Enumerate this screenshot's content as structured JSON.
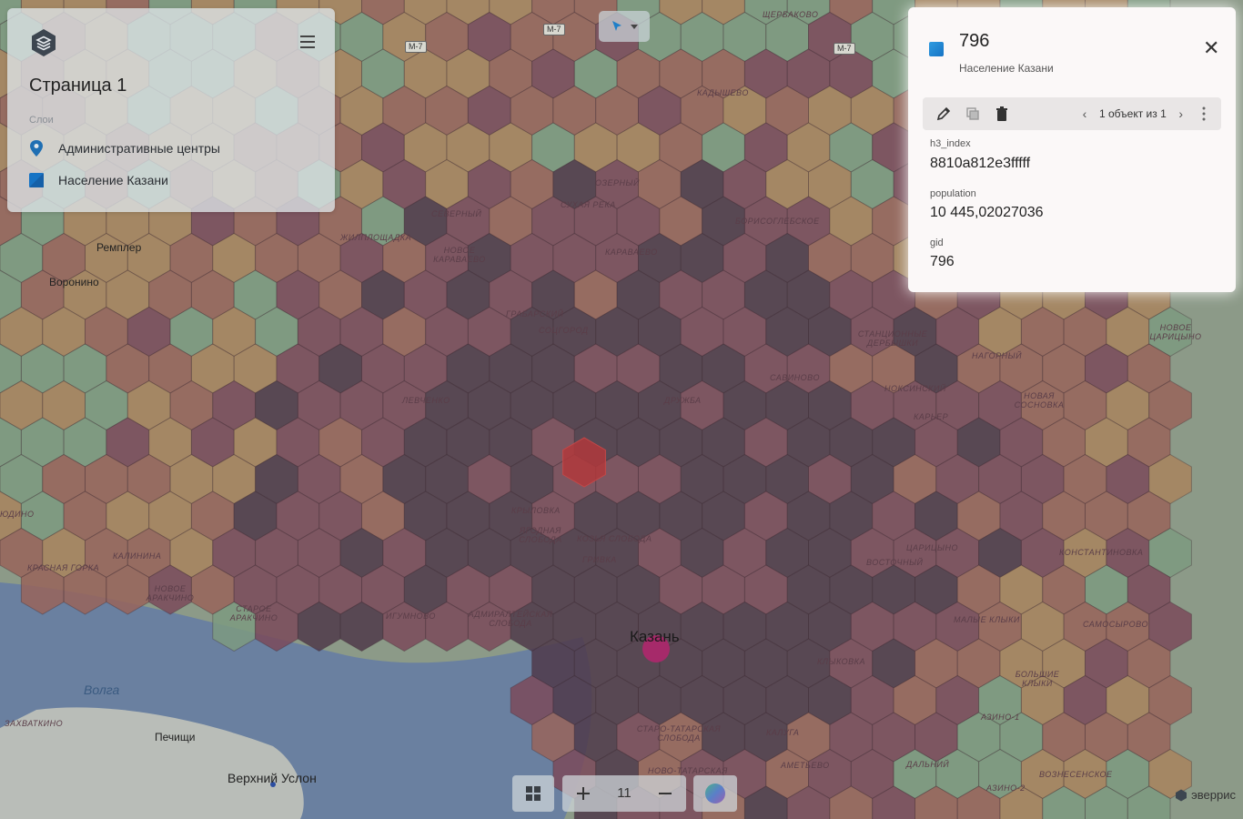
{
  "left_panel": {
    "page_title": "Страница 1",
    "layers_heading": "Слои",
    "layers": [
      {
        "label": "Административные центры",
        "icon": "map-pin-icon",
        "color": "#1f6fb3"
      },
      {
        "label": "Население Казани",
        "icon": "polygon-layer-icon",
        "color": "#1773c4"
      }
    ]
  },
  "info_panel": {
    "title": "796",
    "subtitle": "Население Казани",
    "pager_text": "1 объект из 1",
    "fields": [
      {
        "key": "h3_index",
        "value": "8810a812e3fffff"
      },
      {
        "key": "population",
        "value": "10 445,02027036"
      },
      {
        "key": "gid",
        "value": "796"
      }
    ]
  },
  "zoom": {
    "level": "11"
  },
  "attribution": "эверрис",
  "map_labels": {
    "city": "Казань",
    "river": "Волга",
    "towns": [
      "Ремплер",
      "Воронино",
      "Печищи",
      "Верхний Услон"
    ],
    "roads": [
      "M-7",
      "M-7",
      "M-7"
    ],
    "districts": [
      "ЩЕРБАКОВО",
      "КАДЫШЕВО",
      "ОЗЕРНЫЙ",
      "СУХАЯ РЕКА",
      "СЕВЕРНЫЙ",
      "ЖИЛПЛОЩАДКА",
      "НОВОЕ КАРАВАЕВО",
      "КАРАВАЕВО",
      "БОРИСОГЛЕБСКОЕ",
      "ГРАБАРСКИЙ",
      "СОЦГОРОД",
      "ЛЕВЧЕНКО",
      "ДРУЖБА",
      "САВИНОВО",
      "НОКСИНСКИЙ",
      "КАРЬЕР",
      "НАГОРНЫЙ",
      "НОВАЯ СОСНОВКА",
      "НОВОЕ ЦАРИЦЫНО",
      "СТАНЦИОННЫЕ ДЕРБЫШКИ",
      "КРЫЛОВКА",
      "ЯГОДНАЯ СЛОБОДА",
      "КОЗЬЯ СЛОБОДА",
      "ГРИВКА",
      "КАЛИНИНА",
      "КРАСНАЯ ГОРКА",
      "НОВОЕ АРАКЧИНО",
      "СТАРОЕ АРАКЧИНО",
      "ИГУМНОВО",
      "АДМИРАЛТЕЙСКАЯ СЛОБОДА",
      "ВОСТОЧНЫЙ",
      "ЦАРИЦЫНО",
      "КОНСТАНТИНОВКА",
      "МАЛЫЕ КЛЫКИ",
      "САМОСЫРОВО",
      "КЛЫКОВКА",
      "БОЛЬШИЕ КЛЫКИ",
      "АЗИНО-1",
      "СТАРО-ТАТАРСКАЯ СЛОБОДА",
      "КАЛУГА",
      "АМЕТЬЕВО",
      "ДАЛЬНИЙ",
      "ВОЗНЕСЕНСКОЕ",
      "НОВО-ТАТАРСКАЯ",
      "АЗИНО-2",
      "ЗАХВАТКИНО",
      "ЮДИНО"
    ]
  },
  "colors": {
    "hex_dark": "#4f3a4a",
    "hex_mid": "#7a4a5a",
    "hex_brown": "#98645a",
    "hex_tan": "#a8845e",
    "hex_green": "#7d9a80",
    "hex_selected": "#b0383c",
    "water": "#6a80a0",
    "point": "#a62a6a"
  }
}
